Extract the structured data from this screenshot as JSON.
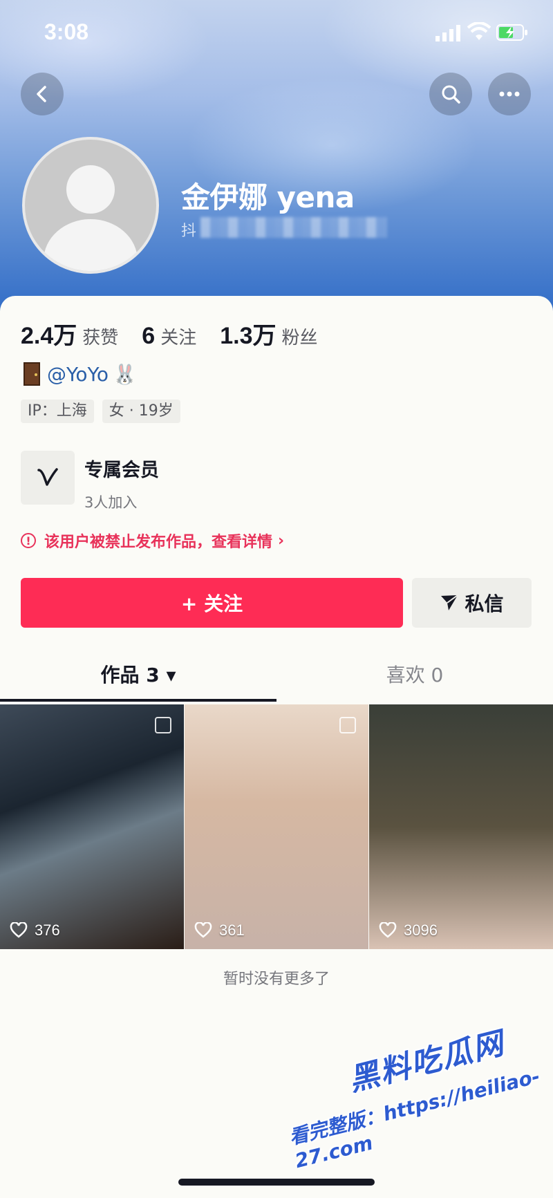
{
  "status_bar": {
    "time": "3:08"
  },
  "header": {
    "username": "金伊娜 yena",
    "douyin_id_prefix": "抖"
  },
  "stats": [
    {
      "value": "2.4万",
      "label": "获赞"
    },
    {
      "value": "6",
      "label": "关注"
    },
    {
      "value": "1.3万",
      "label": "粉丝"
    }
  ],
  "bio": {
    "text": "@YoYo",
    "emoji_trailing": "🐰"
  },
  "tags": [
    "IP：上海",
    "女 · 19岁"
  ],
  "membership": {
    "title": "专属会员",
    "subtitle": "3人加入"
  },
  "ban_notice": {
    "text": "该用户被禁止发布作品，查看详情",
    "chevron": "›"
  },
  "actions": {
    "follow": "+ 关注",
    "message": "私信"
  },
  "tabs": [
    {
      "label": "作品 3 ▾",
      "active": true
    },
    {
      "label": "喜欢 0",
      "active": false
    }
  ],
  "videos": [
    {
      "likes": "376"
    },
    {
      "likes": "361"
    },
    {
      "likes": "3096"
    }
  ],
  "footer": {
    "no_more": "暂时没有更多了"
  },
  "watermark": {
    "brand": "黑料吃瓜网",
    "url": "看完整版：https://heiliao-27.com"
  },
  "colors": {
    "accent": "#fe2c55",
    "ban_red": "#e8325a",
    "link_blue": "#2a5fa8"
  }
}
